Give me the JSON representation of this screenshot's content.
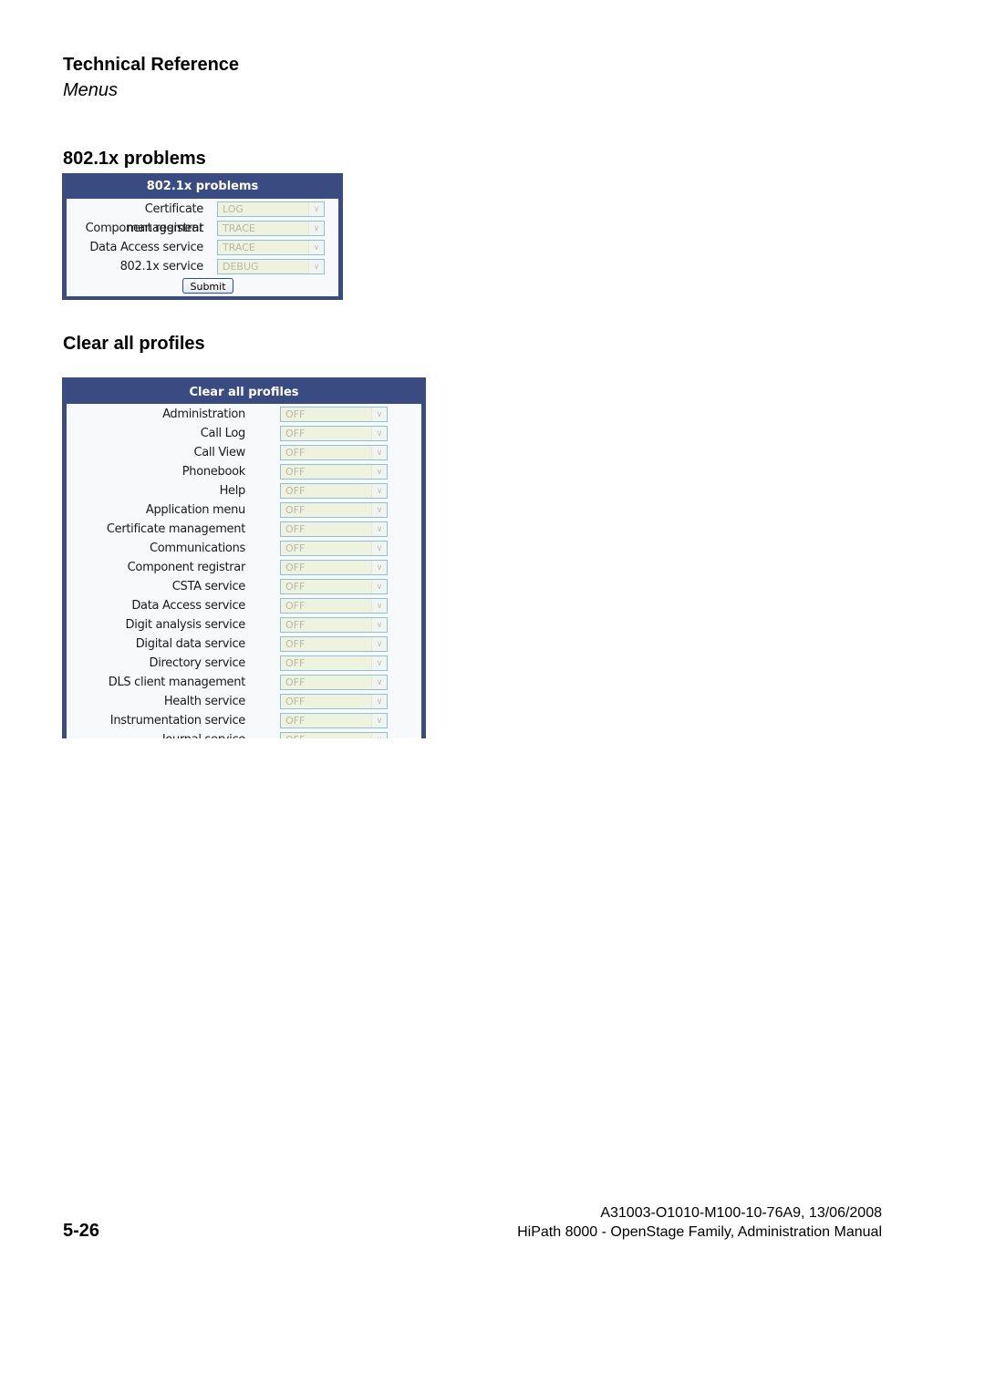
{
  "header": {
    "title": "Technical Reference",
    "subtitle": "Menus"
  },
  "section1": {
    "title": "802.1x problems",
    "panel_title": "802.1x problems",
    "rows": [
      {
        "label": "Certificate management",
        "value": "LOG"
      },
      {
        "label": "Component registrar",
        "value": "TRACE"
      },
      {
        "label": "Data Access service",
        "value": "TRACE"
      },
      {
        "label": "802.1x service",
        "value": "DEBUG"
      }
    ],
    "submit_label": "Submit"
  },
  "section2": {
    "title": "Clear all profiles",
    "panel_title": "Clear all profiles",
    "rows": [
      {
        "label": "Administration",
        "value": "OFF"
      },
      {
        "label": "Call Log",
        "value": "OFF"
      },
      {
        "label": "Call View",
        "value": "OFF"
      },
      {
        "label": "Phonebook",
        "value": "OFF"
      },
      {
        "label": "Help",
        "value": "OFF"
      },
      {
        "label": "Application menu",
        "value": "OFF"
      },
      {
        "label": "Certificate management",
        "value": "OFF"
      },
      {
        "label": "Communications",
        "value": "OFF"
      },
      {
        "label": "Component registrar",
        "value": "OFF"
      },
      {
        "label": "CSTA service",
        "value": "OFF"
      },
      {
        "label": "Data Access service",
        "value": "OFF"
      },
      {
        "label": "Digit analysis service",
        "value": "OFF"
      },
      {
        "label": "Digital data service",
        "value": "OFF"
      },
      {
        "label": "Directory service",
        "value": "OFF"
      },
      {
        "label": "DLS client management",
        "value": "OFF"
      },
      {
        "label": "Health service",
        "value": "OFF"
      },
      {
        "label": "Instrumentation service",
        "value": "OFF"
      },
      {
        "label": "Journal service",
        "value": "OFF"
      }
    ]
  },
  "footer": {
    "page_number": "5-26",
    "doc_id": "A31003-O1010-M100-10-76A9, 13/06/2008",
    "doc_title": "HiPath 8000 - OpenStage Family, Administration Manual"
  },
  "icons": {
    "dropdown_arrow": "⌵"
  },
  "colors": {
    "panel_header": "#3a4b82",
    "select_bg": "#eef2df",
    "select_border": "#8fbfe0"
  }
}
